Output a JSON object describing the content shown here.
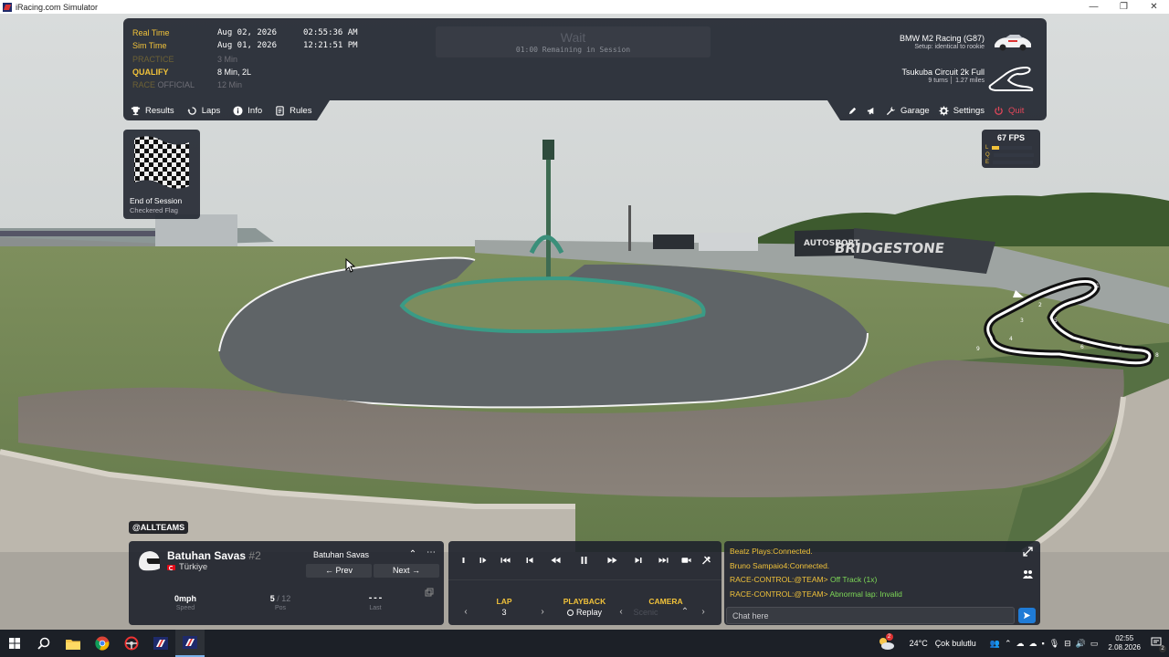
{
  "window": {
    "title": "iRacing.com Simulator",
    "minimize": "—",
    "restore": "❐",
    "close": "✕"
  },
  "session": {
    "rows": [
      {
        "label": "Real Time",
        "value1": "Aug 02, 2026",
        "value2": "02:55:36 AM",
        "style": "yellow"
      },
      {
        "label": "Sim Time",
        "value1": "Aug 01, 2026",
        "value2": "12:21:51 PM",
        "style": "yellow"
      },
      {
        "label": "PRACTICE",
        "value1": "3 Min",
        "value2": "",
        "style": "dim"
      },
      {
        "label": "QUALIFY",
        "value1": "8 Min, 2L",
        "value2": "",
        "style": "yellow"
      },
      {
        "label": "RACE",
        "label_suffix": "OFFICIAL",
        "value1": "12 Min",
        "value2": "",
        "style": "dim"
      }
    ],
    "status_title": "Wait",
    "status_subtitle": "01:00 Remaining in Session",
    "car_name": "BMW M2 Racing (G87)",
    "car_setup": "Setup: identical to rookie",
    "track_name": "Tsukuba Circuit 2k Full",
    "track_turns": "9 turns",
    "track_length": "1.27 miles"
  },
  "menu_left": [
    {
      "label": "Results",
      "icon": "trophy-icon"
    },
    {
      "label": "Laps",
      "icon": "laps-icon"
    },
    {
      "label": "Info",
      "icon": "info-icon"
    },
    {
      "label": "Rules",
      "icon": "rules-icon"
    }
  ],
  "menu_right": {
    "garage": "Garage",
    "settings": "Settings",
    "quit": "Quit"
  },
  "end_of_session": {
    "title": "End of Session",
    "subtitle": "Checkered Flag"
  },
  "fps": {
    "text": "67 FPS",
    "rows": [
      {
        "label": "L",
        "level": 0.18
      },
      {
        "label": "Q",
        "level": 0
      },
      {
        "label": "E",
        "level": 0
      }
    ]
  },
  "track_map": {
    "corner_labels": [
      "1",
      "2",
      "3",
      "4",
      "5",
      "6",
      "7",
      "8",
      "9"
    ]
  },
  "driver": {
    "team_tag": "@ALLTEAMS",
    "name": "Batuhan Savas",
    "number": "#2",
    "country": "Türkiye",
    "selected": "Batuhan Savas",
    "prev": "← Prev",
    "next": "Next →",
    "speed_value": "0mph",
    "speed_label": "Speed",
    "pos_value": "5",
    "pos_total": "/ 12",
    "pos_label": "Pos",
    "last_value": "---",
    "last_label": "Last"
  },
  "replay": {
    "lap_label": "LAP",
    "lap_value": "3",
    "playback_label": "PLAYBACK",
    "playback_value": "Replay",
    "camera_label": "CAMERA",
    "camera_value": "Scenic"
  },
  "chat": {
    "messages": [
      {
        "name": "Beatz Plays:",
        "text": "Connected.",
        "text_style": "yellow"
      },
      {
        "name": "Bruno Sampaio4:",
        "text": "Connected.",
        "text_style": "yellow"
      },
      {
        "name": "RACE-CONTROL:@TEAM>",
        "text": "Off Track (1x)",
        "text_style": "green"
      },
      {
        "name": "RACE-CONTROL:@TEAM>",
        "text": "Abnormal lap: Invalid",
        "text_style": "green"
      }
    ],
    "input_placeholder": "Chat here"
  },
  "taskbar": {
    "weather_temp": "24°C",
    "weather_text": "Çok bulutlu",
    "weather_badge": "2",
    "time": "02:55",
    "date": "2.08.2026",
    "notification_badge": "2"
  },
  "colors": {
    "accent_yellow": "#f1c23a",
    "panel_bg": "#1e222c",
    "quit_red": "#e2475a",
    "chat_green": "#7ed957",
    "send_blue": "#1f7bd6"
  }
}
